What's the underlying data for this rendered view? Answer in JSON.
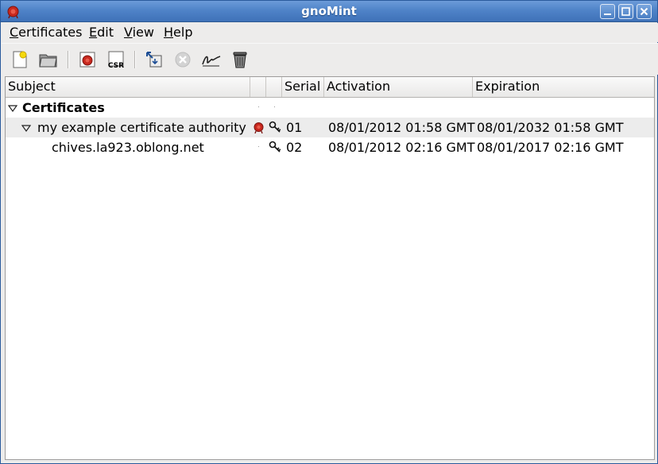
{
  "window": {
    "title": "gnoMint",
    "app_icon": "gnomint-seal-icon",
    "controls": [
      "minimize-icon",
      "maximize-icon",
      "close-icon"
    ]
  },
  "menubar": {
    "items": [
      {
        "label": "Certificates",
        "mnemonic": "C"
      },
      {
        "label": "Edit",
        "mnemonic": "E"
      },
      {
        "label": "View",
        "mnemonic": "V"
      },
      {
        "label": "Help",
        "mnemonic": "H"
      }
    ]
  },
  "toolbar": {
    "buttons": [
      {
        "icon": "new-file-icon",
        "enabled": true
      },
      {
        "icon": "open-folder-icon",
        "enabled": true
      },
      {
        "icon": "add-ca-icon",
        "enabled": true
      },
      {
        "icon": "csr-icon",
        "text": "CSR",
        "enabled": true
      },
      {
        "icon": "import-export-icon",
        "enabled": true
      },
      {
        "icon": "revoke-icon",
        "enabled": false
      },
      {
        "icon": "sign-icon",
        "enabled": true
      },
      {
        "icon": "trash-icon",
        "enabled": true
      }
    ]
  },
  "tree": {
    "columns": {
      "subject": "Subject",
      "serial": "Serial",
      "activation": "Activation",
      "expiration": "Expiration"
    },
    "group": {
      "label": "Certificates",
      "expanded": true
    },
    "rows": [
      {
        "subject": "my example certificate authority",
        "icons": [
          "ca-seal-icon",
          "key-icon"
        ],
        "serial": "01",
        "activation": "08/01/2012 01:58 GMT",
        "expiration": "08/01/2032 01:58 GMT",
        "expanded": true,
        "selected": true
      },
      {
        "subject": "chives.la923.oblong.net",
        "icons": [
          "key-icon"
        ],
        "serial": "02",
        "activation": "08/01/2012 02:16 GMT",
        "expiration": "08/01/2017 02:16 GMT",
        "selected": false
      }
    ]
  },
  "colors": {
    "titlebar": "#4f83c8",
    "selected_row": "#ececec",
    "seal_red": "#c8281e"
  }
}
